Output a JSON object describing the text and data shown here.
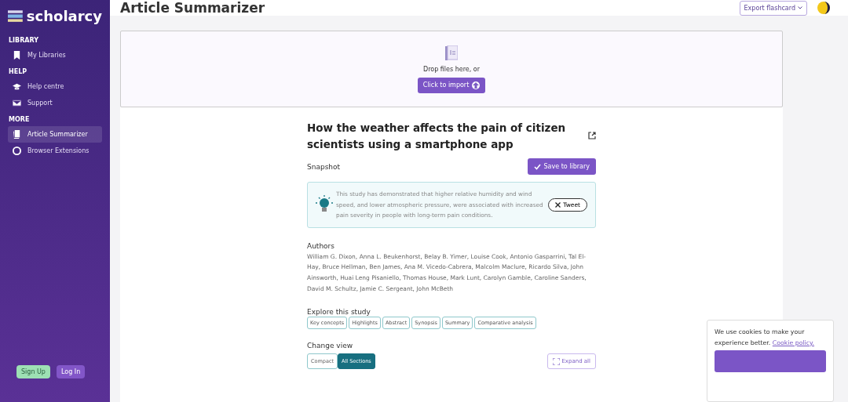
{
  "sidebar": {
    "logo": "scholarcy",
    "sections": [
      {
        "heading": "LIBRARY",
        "items": [
          {
            "label": "My Libraries",
            "selected": false
          }
        ]
      },
      {
        "heading": "HELP",
        "items": [
          {
            "label": "Help centre",
            "selected": false
          },
          {
            "label": "Support",
            "selected": false
          }
        ]
      },
      {
        "heading": "MORE",
        "items": [
          {
            "label": "Article Summarizer",
            "selected": true
          },
          {
            "label": "Browser Extensions",
            "selected": false
          }
        ]
      }
    ],
    "buttons": [
      {
        "label": "Sign Up",
        "kind": "signup"
      },
      {
        "label": "Log In",
        "kind": "login"
      }
    ]
  },
  "header": {
    "title": "Article Summarizer",
    "export": "Export flashcard"
  },
  "dropzone": {
    "text": "Drop files here, or",
    "button": "Click to import"
  },
  "article": {
    "title": "How the weather affects the pain of citizen scientists using a smartphone app",
    "snapshot_label": "Snapshot",
    "save_button": "Save to library",
    "snapshot": "This study has demonstrated that higher relative humidity and wind speed, and lower atmospheric pressure, were associated with increased pain severity in people with long-term pain conditions.",
    "tweet": "Tweet",
    "authors_heading": "Authors",
    "authors": "William G. Dixon, Anna L. Beukenhorst, Belay B. Yimer, Louise Cook, Antonio Gasparrini, Tal El-Hay, Bruce Hellman, Ben James, Ana M. Vicedo-Cabrera, Malcolm Maclure, Ricardo Silva, John Ainsworth, Huai Leng Pisaniello, Thomas House, Mark Lunt, Carolyn Gamble, Caroline Sanders, David M. Schultz, Jamie C. Sergeant, John McBeth",
    "explore_heading": "Explore this study",
    "explore": [
      "Key concepts",
      "Highlights",
      "Abstract",
      "Synopsis",
      "Summary",
      "Comparative analysis"
    ],
    "view_heading": "Change view",
    "views": [
      {
        "label": "Compact",
        "selected": false
      },
      {
        "label": "All Sections",
        "selected": true
      }
    ],
    "expand": "Expand all"
  },
  "cookie": {
    "text": "We use cookies to make your experience better.",
    "link": "Cookie policy."
  }
}
